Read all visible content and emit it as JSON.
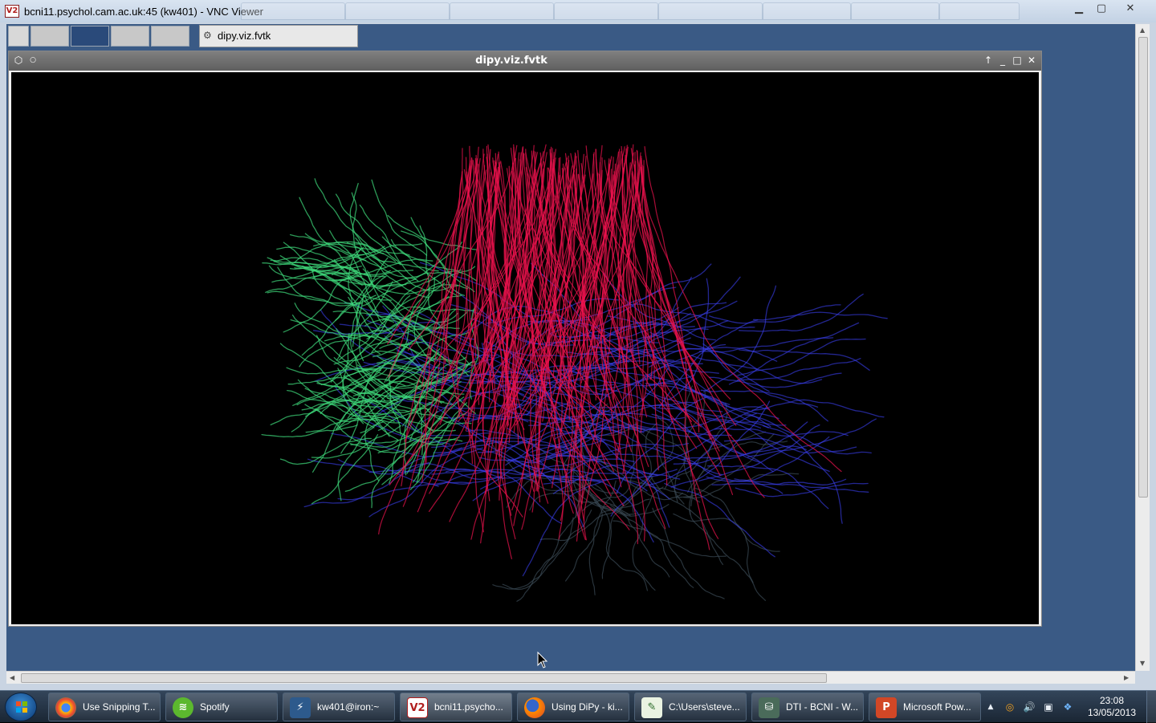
{
  "vnc": {
    "title": "bcni11.psychol.cam.ac.uk:45 (kw401) - VNC Viewer",
    "logo": "V2",
    "controls": {
      "minimize": "▁",
      "maximize": "▢",
      "close": "✕"
    }
  },
  "remote_panel": {
    "task_item_label": "dipy.viz.fvtk",
    "task_item_icon": "gear-icon"
  },
  "fvtk_window": {
    "title": "dipy.viz.fvtk",
    "controls": {
      "raise": "↑",
      "minimize": "_",
      "maximize": "□",
      "close": "✕"
    }
  },
  "tractography": {
    "colors": {
      "green": "#3fdc7c",
      "red": "#f0134f",
      "blue": "#3a3ff0",
      "dark": "#3b4a55"
    }
  },
  "taskbar": {
    "items": [
      {
        "label": "Use Snipping T...",
        "icon": "chrome-icon"
      },
      {
        "label": "Spotify",
        "icon": "spotify-icon"
      },
      {
        "label": "kw401@iron:~",
        "icon": "putty-icon"
      },
      {
        "label": "bcni11.psycho...",
        "icon": "vnc-icon"
      },
      {
        "label": "Using DiPy - ki...",
        "icon": "firefox-icon"
      },
      {
        "label": "C:\\Users\\steve...",
        "icon": "notepad-icon"
      },
      {
        "label": "DTI - BCNI - W...",
        "icon": "network-icon"
      },
      {
        "label": "Microsoft Pow...",
        "icon": "powerpoint-icon"
      }
    ],
    "clock": {
      "time": "23:08",
      "date": "13/05/2013"
    }
  }
}
